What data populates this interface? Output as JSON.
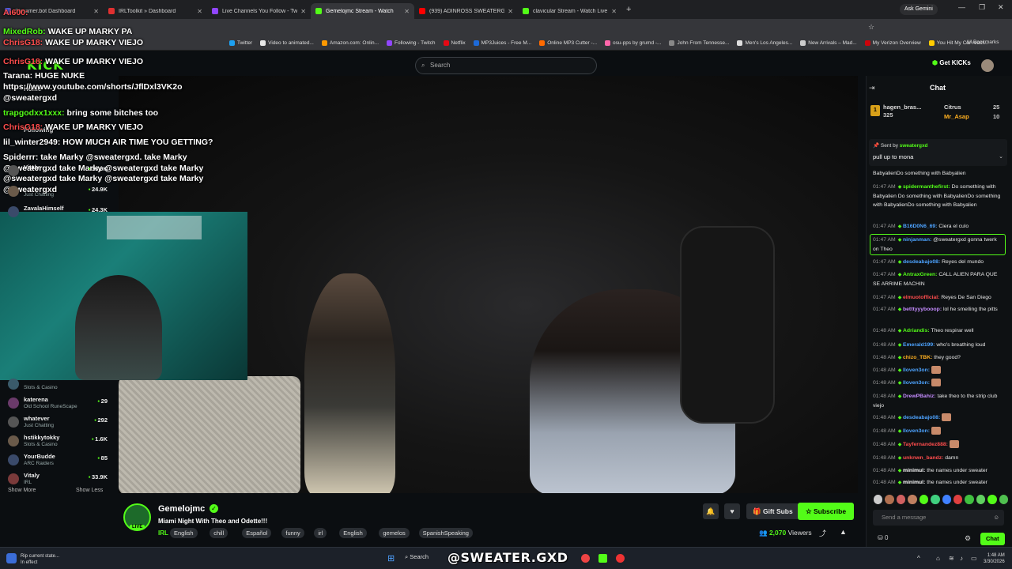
{
  "browser": {
    "tabs": [
      {
        "title": "Streamer.bot Dashboard",
        "color": "#5865f2",
        "active": false
      },
      {
        "title": "IRLToolkit » Dashboard",
        "color": "#e03030",
        "active": false
      },
      {
        "title": "Live Channels You Follow - Twit",
        "color": "#9146ff",
        "active": false
      },
      {
        "title": "Gemelojmc Stream - Watch",
        "color": "#53fc18",
        "active": true
      },
      {
        "title": "(939) ADINROSS SWEATERGXD",
        "color": "#ff0000",
        "active": false
      },
      {
        "title": "clavicular Stream - Watch Live",
        "color": "#53fc18",
        "active": false
      }
    ],
    "ask_gemini": "Ask Gemini",
    "bookmarks": [
      "Twitter",
      "Video to animated...",
      "Amazon.com: Onlin...",
      "Following - Twitch",
      "Netflix",
      "MP3Juices - Free M...",
      "Online MP3 Cutter -...",
      "osu-pps by grumd -...",
      "John From Tennesse...",
      "Men's Los Angeles...",
      "New Arrivals – Mad...",
      "My Verizon Overview",
      "You Hit My Car react..."
    ],
    "all_bookmarks": "All Bookmarks"
  },
  "header": {
    "logo": "KICK",
    "search_placeholder": "Search",
    "get_kicks": "Get KICKs"
  },
  "sidebar": {
    "home": "Home",
    "following": "Following",
    "top_items": [
      {
        "name": "Vitaly",
        "category": "",
        "viewers": "33.9K"
      },
      {
        "name": "",
        "category": "Just Chatting",
        "viewers": "24.9K"
      },
      {
        "name": "ZavalaHimself",
        "category": "",
        "viewers": "24.3K"
      }
    ],
    "items": [
      {
        "name": "",
        "category": "Slots & Casino",
        "viewers": ""
      },
      {
        "name": "katerena",
        "category": "Old School RuneScape",
        "viewers": "29"
      },
      {
        "name": "whatever",
        "category": "Just Chatting",
        "viewers": "292"
      },
      {
        "name": "hstikkytokky",
        "category": "Slots & Casino",
        "viewers": "1.6K"
      },
      {
        "name": "YourBudde",
        "category": "ARC Raiders",
        "viewers": "85"
      },
      {
        "name": "Vitaly",
        "category": "IRL",
        "viewers": "33.9K"
      }
    ],
    "show_more": "Show More",
    "show_less": "Show Less"
  },
  "overlay_chat": [
    {
      "user": "Ai600:",
      "user_color": "#ff4d4d",
      "text": ""
    },
    {
      "user": "MixedRob:",
      "user_color": "#53fc18",
      "text": "WAKE UP MARKY PA"
    },
    {
      "user": "ChrisG18:",
      "user_color": "#ff4d4d",
      "text": "WAKE UP MARKY VIEJO"
    },
    {
      "user": "ChrisG18:",
      "user_color": "#ff4d4d",
      "text": "WAKE UP MARKY VIEJO"
    },
    {
      "user": "Tarana:",
      "user_color": "#ffffff",
      "text": "HUGE NUKE"
    },
    {
      "user": "",
      "user_color": "#ffffff",
      "text": "https://www.youtube.com/shorts/JflDxl3VK2o"
    },
    {
      "user": "",
      "user_color": "#ffffff",
      "text": "@sweatergxd"
    },
    {
      "user": "trapgodxx1xxx:",
      "user_color": "#53fc18",
      "text": "bring some bitches too"
    },
    {
      "user": "ChrisG18:",
      "user_color": "#ff4d4d",
      "text": "WAKE UP MARKY VIEJO"
    },
    {
      "user": "lil_winter2949:",
      "user_color": "#ffffff",
      "text": "HOW MUCH AIR TIME YOU GETTING?"
    },
    {
      "user": "Spiderrr:",
      "user_color": "#ffffff",
      "text": "take Marky @sweatergxd. take Marky"
    },
    {
      "user": "",
      "user_color": "#ffffff",
      "text": "@sweatergxd take Marky @sweatergxd take Marky"
    },
    {
      "user": "",
      "user_color": "#ffffff",
      "text": "@sweatergxd take Marky @sweatergxd take Marky"
    },
    {
      "user": "",
      "user_color": "#ffffff",
      "text": "@sweatergxd"
    }
  ],
  "channel": {
    "name": "Gemelojmc",
    "live": "LIVE",
    "title": "Miami Night With Theo and Odette!!!",
    "category": "IRL",
    "tags": [
      "English",
      "chill",
      "Español",
      "funny",
      "irl",
      "English",
      "gemelos",
      "SpanishSpeaking"
    ],
    "gift_subs": "Gift Subs",
    "subscribe": "Subscribe",
    "viewers": "2,070",
    "viewers_label": "Viewers"
  },
  "chat": {
    "title": "Chat",
    "leaderboard": [
      {
        "rank": "1",
        "name": "hagen_bras...",
        "count": "325"
      },
      {
        "rank": "",
        "name": "Citrus",
        "count": "25"
      },
      {
        "rank": "",
        "name": "Mr_Asap",
        "count": "10"
      }
    ],
    "pinned_by_label": "Sent by",
    "pinned_by": "sweatergxd",
    "pinned_text": "pull up to mona",
    "messages": [
      {
        "time": "",
        "user": "",
        "color": "#e8e8e8",
        "text": "BabyalienDo something with Babyalien",
        "highlight": false
      },
      {
        "time": "01:47 AM",
        "user": "spidermanthefirst:",
        "color": "#53fc18",
        "text": "Do something with Babyalien Do something with BabyalienDo something with BabyalienDo something with Babyalien",
        "highlight": false
      },
      {
        "time": "01:47 AM",
        "user": "B16D0N6_69:",
        "color": "#4da3ff",
        "text": "Ciera el culo",
        "highlight": false
      },
      {
        "time": "01:47 AM",
        "user": "ninjanman:",
        "color": "#4da3ff",
        "text": "@sweatergxd gonna twerk on Theo",
        "highlight": true
      },
      {
        "time": "01:47 AM",
        "user": "desdeabajo08:",
        "color": "#4da3ff",
        "text": "Reyes del mundo",
        "highlight": false
      },
      {
        "time": "01:47 AM",
        "user": "AntraxGreen:",
        "color": "#53fc18",
        "text": "CALL ALIEN PARA QUE SE ARRIME MACHIN",
        "highlight": false
      },
      {
        "time": "01:47 AM",
        "user": "elmuotofficial:",
        "color": "#ff4d4d",
        "text": "Reyes De San Diego",
        "highlight": false
      },
      {
        "time": "01:47 AM",
        "user": "betttyyybooop:",
        "color": "#c58cff",
        "text": "lol he smelling the pitts",
        "highlight": false
      },
      {
        "time": "01:48 AM",
        "user": "Adriandis:",
        "color": "#53fc18",
        "text": "Theo respirar well",
        "highlight": false
      },
      {
        "time": "01:48 AM",
        "user": "Emerald199:",
        "color": "#4da3ff",
        "text": "who's breathing loud",
        "highlight": false
      },
      {
        "time": "01:48 AM",
        "user": "chizo_TBK:",
        "color": "#ffb020",
        "text": "they good?",
        "highlight": false
      },
      {
        "time": "01:48 AM",
        "user": "lloven3on:",
        "color": "#4da3ff",
        "text": "",
        "highlight": false
      },
      {
        "time": "01:48 AM",
        "user": "lloven3on:",
        "color": "#4da3ff",
        "text": "",
        "highlight": false
      },
      {
        "time": "01:48 AM",
        "user": "DrewPBahiz:",
        "color": "#c58cff",
        "text": "take theo to the strip club viejo",
        "highlight": false
      },
      {
        "time": "01:48 AM",
        "user": "desdeabajo08:",
        "color": "#4da3ff",
        "text": "",
        "highlight": false
      },
      {
        "time": "01:48 AM",
        "user": "lloven3on:",
        "color": "#4da3ff",
        "text": "",
        "highlight": false
      },
      {
        "time": "01:48 AM",
        "user": "Tayfernandez888:",
        "color": "#ff4d4d",
        "text": "",
        "highlight": false
      },
      {
        "time": "01:48 AM",
        "user": "unknwn_bandz:",
        "color": "#ff4d4d",
        "text": "damn",
        "highlight": false
      },
      {
        "time": "01:48 AM",
        "user": "minimul:",
        "color": "#ffffff",
        "text": "the names under sweater",
        "highlight": false
      },
      {
        "time": "01:48 AM",
        "user": "minimul:",
        "color": "#ffffff",
        "text": "the names under sweater",
        "highlight": false
      }
    ],
    "send_placeholder": "Send a message",
    "points": "0",
    "chat_button": "Chat"
  },
  "taskbar": {
    "notif_title": "Rip current state...",
    "notif_sub": "In effect",
    "search": "Search",
    "overlay_handle": "@SWEATER.GXD",
    "time": "1:48 AM",
    "date": "3/30/2026"
  }
}
